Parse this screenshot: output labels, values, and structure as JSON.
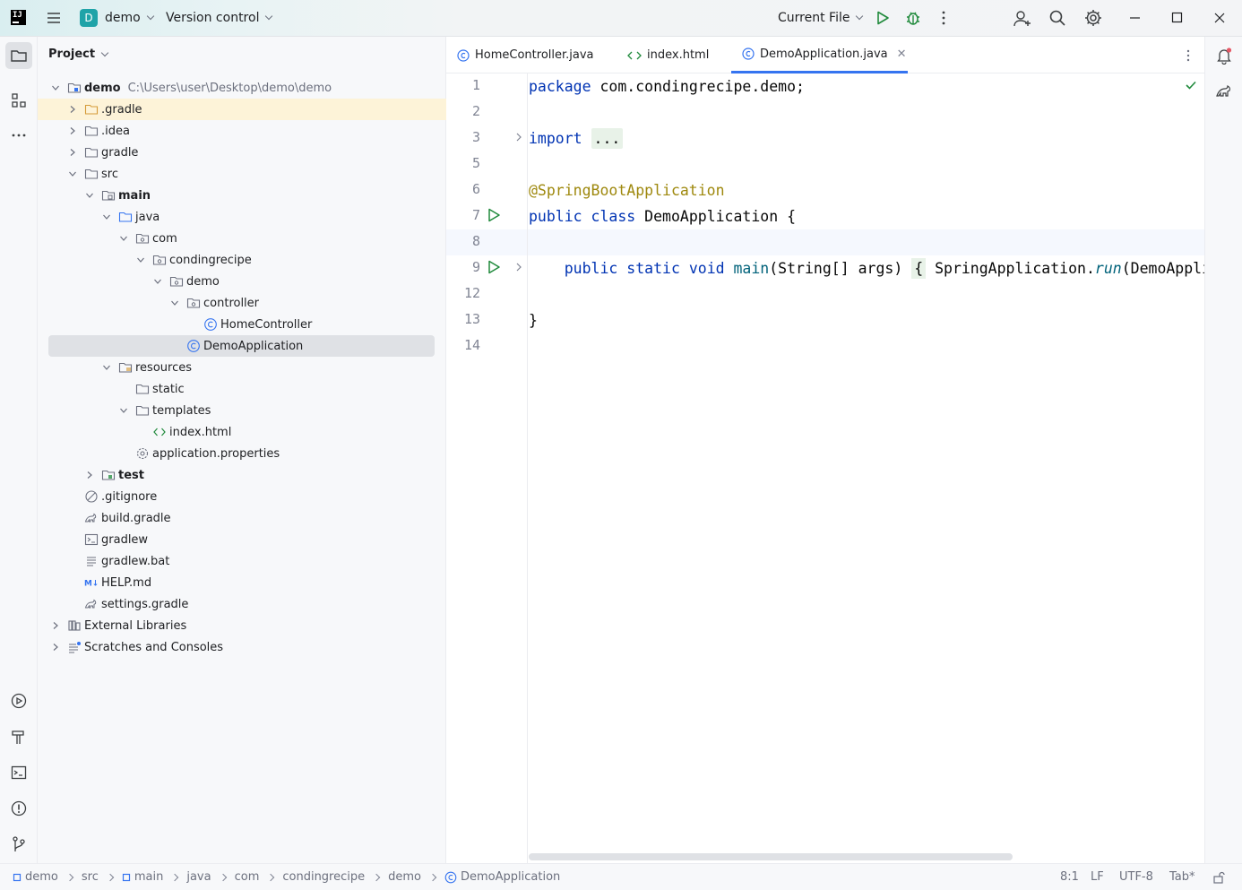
{
  "titlebar": {
    "project_badge": "D",
    "project_name": "demo",
    "vcs_label": "Version control",
    "run_config": "Current File"
  },
  "project_panel": {
    "title": "Project",
    "tree": [
      {
        "label": "demo",
        "path": "C:\\Users\\user\\Desktop\\demo\\demo",
        "depth": 0,
        "expanded": true,
        "icon": "module-folder-icon",
        "bold": true
      },
      {
        "label": ".gradle",
        "depth": 1,
        "expanded": false,
        "icon": "folder-excluded-icon",
        "highlight": true
      },
      {
        "label": ".idea",
        "depth": 1,
        "expanded": false,
        "icon": "folder-icon"
      },
      {
        "label": "gradle",
        "depth": 1,
        "expanded": false,
        "icon": "folder-icon"
      },
      {
        "label": "src",
        "depth": 1,
        "expanded": true,
        "icon": "folder-icon"
      },
      {
        "label": "main",
        "depth": 2,
        "expanded": true,
        "icon": "source-root-folder-icon",
        "bold": true
      },
      {
        "label": "java",
        "depth": 3,
        "expanded": true,
        "icon": "source-folder-icon"
      },
      {
        "label": "com",
        "depth": 4,
        "expanded": true,
        "icon": "package-icon"
      },
      {
        "label": "condingrecipe",
        "depth": 5,
        "expanded": true,
        "icon": "package-icon"
      },
      {
        "label": "demo",
        "depth": 6,
        "expanded": true,
        "icon": "package-icon"
      },
      {
        "label": "controller",
        "depth": 7,
        "expanded": true,
        "icon": "package-icon"
      },
      {
        "label": "HomeController",
        "depth": 8,
        "icon": "java-class-icon"
      },
      {
        "label": "DemoApplication",
        "depth": 7,
        "icon": "java-class-icon",
        "selected": true
      },
      {
        "label": "resources",
        "depth": 3,
        "expanded": true,
        "icon": "resources-folder-icon"
      },
      {
        "label": "static",
        "depth": 4,
        "icon": "folder-icon"
      },
      {
        "label": "templates",
        "depth": 4,
        "expanded": true,
        "icon": "folder-icon"
      },
      {
        "label": "index.html",
        "depth": 5,
        "icon": "html-file-icon"
      },
      {
        "label": "application.properties",
        "depth": 4,
        "icon": "properties-file-icon"
      },
      {
        "label": "test",
        "depth": 2,
        "expanded": false,
        "icon": "test-folder-icon",
        "bold": true
      },
      {
        "label": ".gitignore",
        "depth": 1,
        "icon": "gitignore-file-icon"
      },
      {
        "label": "build.gradle",
        "depth": 1,
        "icon": "gradle-file-icon"
      },
      {
        "label": "gradlew",
        "depth": 1,
        "icon": "shell-script-icon"
      },
      {
        "label": "gradlew.bat",
        "depth": 1,
        "icon": "text-file-icon"
      },
      {
        "label": "HELP.md",
        "depth": 1,
        "icon": "markdown-file-icon"
      },
      {
        "label": "settings.gradle",
        "depth": 1,
        "icon": "gradle-file-icon"
      },
      {
        "label": "External Libraries",
        "depth": 0,
        "expanded": false,
        "icon": "libraries-icon"
      },
      {
        "label": "Scratches and Consoles",
        "depth": 0,
        "expanded": false,
        "icon": "scratches-icon"
      }
    ]
  },
  "editor": {
    "tabs": [
      {
        "label": "HomeController.java",
        "icon": "java-class-icon"
      },
      {
        "label": "index.html",
        "icon": "html-file-icon"
      },
      {
        "label": "DemoApplication.java",
        "icon": "java-class-icon",
        "active": true
      }
    ],
    "line_numbers": [
      "1",
      "2",
      "3",
      "5",
      "6",
      "7",
      "8",
      "9",
      "12",
      "13",
      "14"
    ],
    "code": {
      "l1_kw": "package",
      "l1_rest": " com.condingrecipe.demo;",
      "l3_kw": "import",
      "l3_fold": "...",
      "l6_ann": "@SpringBootApplication",
      "l7_kw": "public class",
      "l7_rest": " DemoApplication {",
      "l9_kw": "public static void",
      "l9_fn": "main",
      "l9_args": "(String[] args) ",
      "l9_brace": "{",
      "l9_cls": " SpringApplication.",
      "l9_run": "run",
      "l9_tail": "(DemoAppli",
      "l13": "}"
    }
  },
  "statusbar": {
    "breadcrumbs": [
      "demo",
      "src",
      "main",
      "java",
      "com",
      "condingrecipe",
      "demo",
      "DemoApplication"
    ],
    "position": "8:1",
    "line_sep": "LF",
    "encoding": "UTF-8",
    "indent": "Tab*"
  },
  "colors": {
    "accent": "#3574f0",
    "run_green": "#208a3c",
    "keyword": "#0033b3",
    "annotation": "#9e880d",
    "selection": "#dfe1e5",
    "highlight": "#fdf3d8"
  }
}
